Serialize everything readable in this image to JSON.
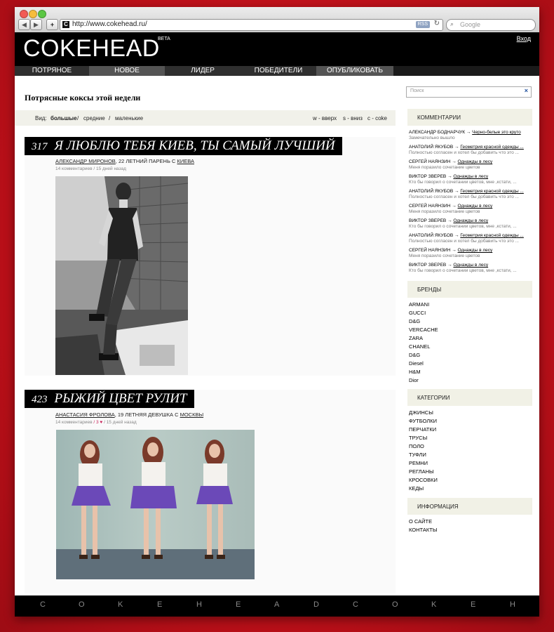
{
  "browser": {
    "url": "http://www.cokehead.ru/",
    "rss_label": "RSS",
    "search_placeholder": "Google"
  },
  "site": {
    "logo": "COKEHEAD",
    "beta": "BETA",
    "login": "Вход",
    "menu": [
      "ПОТРЯНОЕ",
      "НОВОЕ",
      "ЛИДЕР",
      "ПОБЕДИТЕЛИ",
      "ОПУБЛИКОВАТЬ"
    ]
  },
  "main": {
    "title": "Потрясные коксы этой недели",
    "view": {
      "label": "Вид:",
      "large": "большые",
      "sep1": "/",
      "medium": "средние",
      "sep2": "/",
      "small": "маленькие",
      "key_up": "w - вверх",
      "key_down": "s - вниз",
      "key_coke": "c - coke"
    },
    "posts": [
      {
        "score": "317",
        "title": "Я ЛЮБЛЮ ТЕБЯ КИЕВ, ТЫ САМЫЙ ЛУЧШИЙ",
        "author": "АЛЕКСАНДР МИРОНОВ",
        "desc": ", 22 ЛЕТНИЙ ПАРЕНЬ С ",
        "city": "КИЕВА",
        "comments": "14 комментариев",
        "likes": "",
        "time": "/ 15 дней назад"
      },
      {
        "score": "423",
        "title": "РЫЖИЙ ЦВЕТ РУЛИТ",
        "author": "АНАСТАСИЯ ФРОЛОВА",
        "desc": ", 19 ЛЕТНЯЯ ДЕВУШКА С ",
        "city": "МОСКВЫ",
        "comments": "14 комментариев",
        "likes": "/ 3 ♥",
        "time": "/ 15 дней назад"
      }
    ]
  },
  "sidebar": {
    "search_placeholder": "Поиск",
    "clear_icon": "close-icon",
    "comments_header": "КОММЕНТАРИИ",
    "comments": [
      {
        "user": "АЛЕКСАНДР БОДНАРЧУК",
        "post": "Черно-белые это круто",
        "text": "Замечательно вышло"
      },
      {
        "user": "АНАТОЛИЙ ЯКУБОВ",
        "post": "Геометрия красной одежды ...",
        "text": "Полностью согласен и хотел бы добавить что это ..."
      },
      {
        "user": "СЕРГЕЙ НАЯНЗИН",
        "post": "Однажды в лесу",
        "text": "Меня поразило сочетание цветов"
      },
      {
        "user": "ВИКТОР ЗВЕРЕВ",
        "post": "Однажды в лесу",
        "text": "Кто бы говорил о сочетании цветов, мне ,кстати, ..."
      },
      {
        "user": "АНАТОЛИЙ ЯКУБОВ",
        "post": "Геометрия красной одежды ...",
        "text": "Полностью согласен и хотел бы добавить что это ..."
      },
      {
        "user": "СЕРГЕЙ НАЯНЗИН",
        "post": "Однажды в лесу",
        "text": "Меня поразило сочетание цветов"
      },
      {
        "user": "ВИКТОР ЗВЕРЕВ",
        "post": "Однажды в лесу",
        "text": "Кто бы говорил о сочетании цветов, мне ,кстати, ..."
      },
      {
        "user": "АНАТОЛИЙ ЯКУБОВ",
        "post": "Геометрия красной одежды ...",
        "text": "Полностью согласен и хотел бы добавить что это ..."
      },
      {
        "user": "СЕРГЕЙ НАЯНЗИН",
        "post": "Однажды в лесу",
        "text": "Меня поразило сочетание цветов"
      },
      {
        "user": "ВИКТОР ЗВЕРЕВ",
        "post": "Однажды в лесу",
        "text": "Кто бы говорил о сочетании цветов, мне ,кстати, ..."
      }
    ],
    "brands_header": "БРЕНДЫ",
    "brands": [
      "ARMANI",
      "GUCCI",
      "D&G",
      "VERCACHE",
      "ZARA",
      "CHANEL",
      "D&G",
      "Diesel",
      "H&M",
      "Dior"
    ],
    "categories_header": "КАТЕГОРИИ",
    "categories": [
      "ДЖИНСЫ",
      "ФУТБОЛКИ",
      "ПЕРЧАТКИ",
      "ТРУСЫ",
      "ПОЛО",
      "ТУФЛИ",
      "РЕМНИ",
      "РЕГЛАНЫ",
      "КРОСОВКИ",
      "КЕДЫ"
    ],
    "info_header": "ИНФОРМАЦИЯ",
    "info": [
      "О САЙТЕ",
      "КОНТАКТЫ"
    ]
  },
  "footer": {
    "letters": [
      "C",
      "O",
      "K",
      "E",
      "H",
      "E",
      "A",
      "D",
      "C",
      "O",
      "K",
      "E",
      "H"
    ]
  },
  "colors": {
    "desktop": "#c8121c",
    "header": "#000000",
    "sidebar_head": "#f1f1e6",
    "accent_link": "#1e4f9c"
  }
}
